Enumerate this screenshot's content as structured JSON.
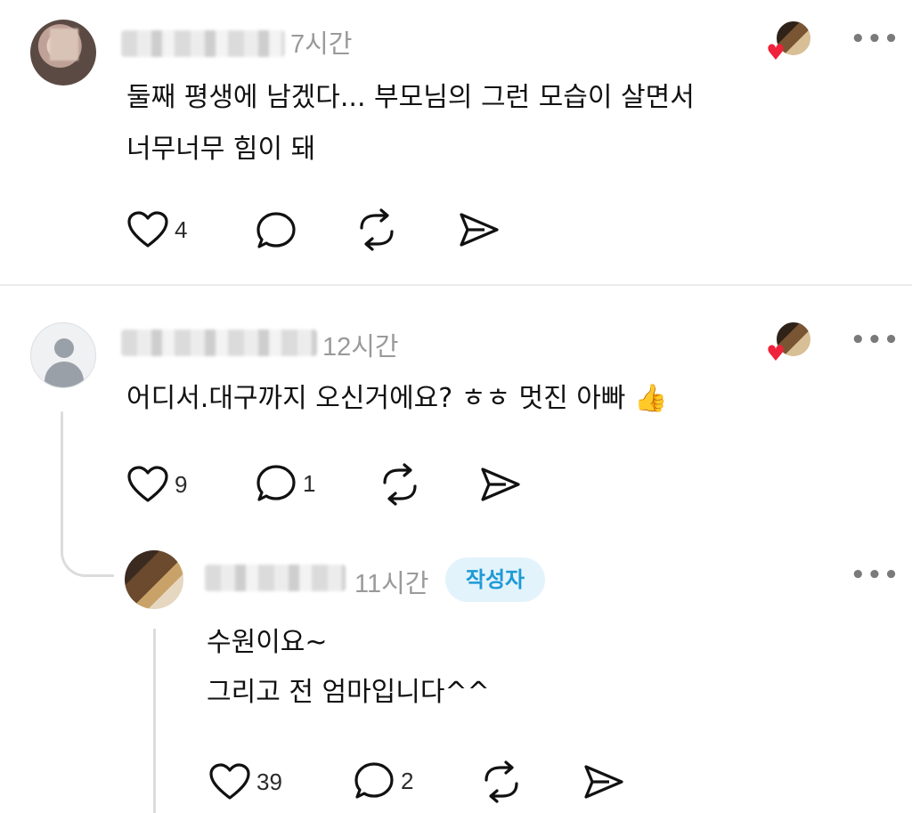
{
  "posts": [
    {
      "time": "7시간",
      "text_lines": [
        "둘째 평생에 남겠다... 부모님의 그런 모습이 살면서",
        "너무너무 힘이 돼"
      ],
      "likes": "4",
      "replies": "",
      "avatar_icon": "profile-photo-avatar"
    },
    {
      "time": "12시간",
      "text_lines": [
        "어디서.대구까지 오신거에요? ㅎㅎ 멋진 아빠 👍"
      ],
      "likes": "9",
      "replies": "1",
      "avatar_icon": "default-user-avatar"
    },
    {
      "time": "11시간",
      "author_badge": "작성자",
      "text_lines": [
        "수원이요~",
        "그리고 전 엄마입니다^^"
      ],
      "likes": "39",
      "replies": "2",
      "avatar_icon": "profile-photo-avatar"
    }
  ],
  "more_label": "•••",
  "heart_glyph": "♥",
  "colors": {
    "accent": "#1e9ad6",
    "badge_bg": "#e3f3fb",
    "heart": "#f0213a",
    "muted": "#9a9a9a"
  }
}
